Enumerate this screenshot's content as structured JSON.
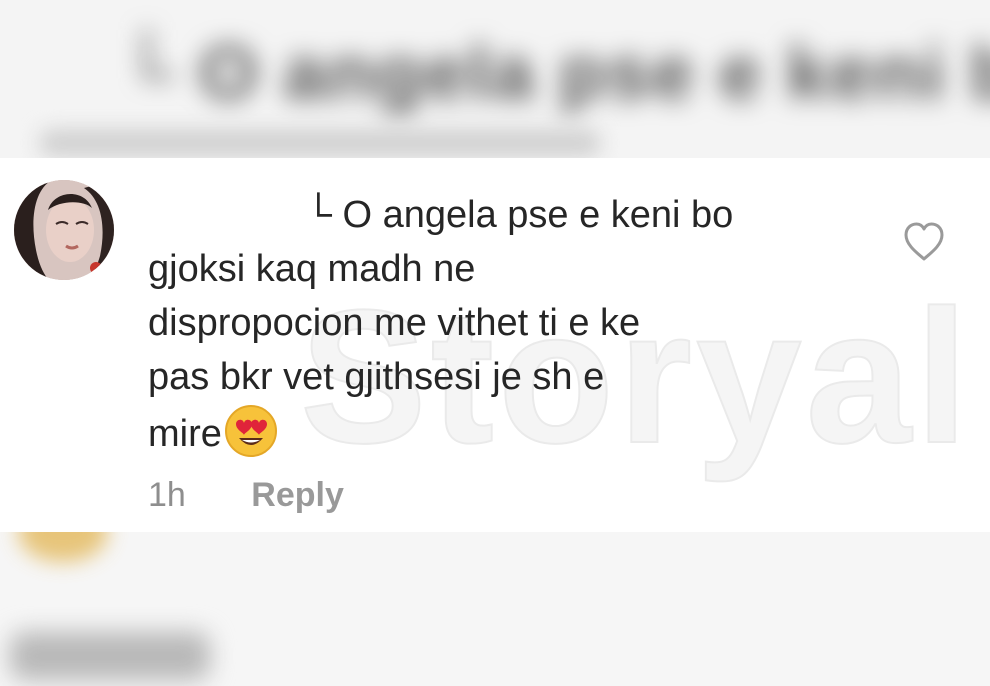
{
  "comment": {
    "lines": [
      "└ O angela pse e keni bo",
      "gjoksi kaq madh ne",
      "dispropocion me vithet ti e ke",
      "pas bkr vet gjithsesi je sh e",
      "mire"
    ],
    "emoji": "heart-eyes-emoji",
    "time": "1h",
    "reply_label": "Reply"
  },
  "icons": {
    "like": "heart-outline-icon",
    "avatar": "profile-avatar"
  },
  "watermark": "Storyal",
  "colors": {
    "text": "#262626",
    "meta": "#8e8e8e",
    "card": "#ffffff"
  }
}
